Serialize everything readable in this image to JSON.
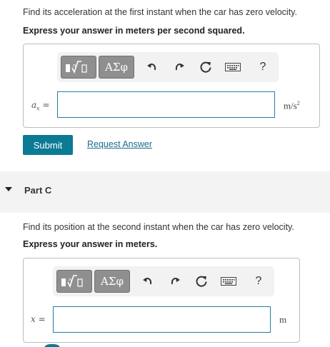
{
  "part_b": {
    "prompt": "Find its acceleration at the first instant when the car has zero velocity.",
    "instruction": "Express your answer in meters per second squared.",
    "variable": "a",
    "variable_sub": "x",
    "equals": "=",
    "input_value": "",
    "unit_main": "m/s",
    "unit_sup": "2"
  },
  "toolbar": {
    "templates_icon": "templates-icon",
    "greek_label": "ΑΣφ",
    "undo_icon": "undo-icon",
    "redo_icon": "redo-icon",
    "reset_icon": "reset-icon",
    "keyboard_icon": "keyboard-icon",
    "help_label": "?"
  },
  "actions": {
    "submit_label": "Submit",
    "request_label": "Request Answer"
  },
  "part_c": {
    "title": "Part C",
    "prompt": "Find its position at the second instant when the car has zero velocity.",
    "instruction": "Express your answer in meters.",
    "variable": "x",
    "equals": "=",
    "input_value": "",
    "unit": "m"
  },
  "colors": {
    "accent": "#0b7a95",
    "link": "#1b6a8c",
    "toolbar_bg": "#f2f2f2",
    "button_gray": "#8f8f8f"
  }
}
